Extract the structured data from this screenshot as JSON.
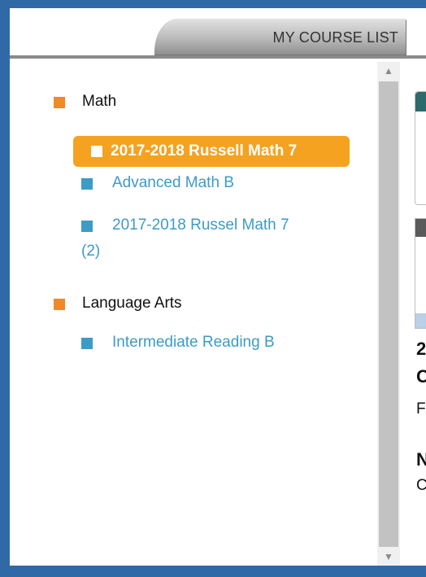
{
  "header": {
    "tab_label": "MY COURSE LIST"
  },
  "subjects": [
    {
      "label": "Math",
      "courses": [
        {
          "label": "2017-2018 Russell Math 7",
          "selected": true
        },
        {
          "label": "Advanced Math B"
        },
        {
          "label": "2017-2018 Russel Math 7",
          "label_suffix": "(2)"
        }
      ]
    },
    {
      "label": "Language Arts",
      "courses": [
        {
          "label": "Intermediate Reading B"
        }
      ]
    }
  ],
  "right_panel": {
    "fragments": [
      "2",
      "C",
      "F",
      "N",
      "C"
    ]
  },
  "colors": {
    "accent": "#f4a21f",
    "subject_marker": "#ef8a2c",
    "link": "#3d9bc6",
    "frame": "#2f6aa6"
  }
}
